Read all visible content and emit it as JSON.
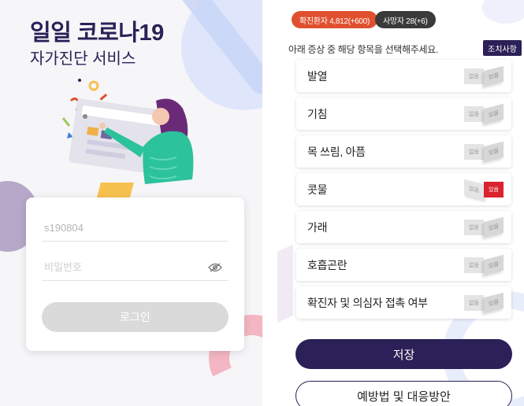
{
  "login": {
    "title": "일일 코로나19",
    "subtitle": "자가진단 서비스",
    "id_value": "s190804",
    "password_placeholder": "비밀번호",
    "login_label": "로그인",
    "eye_icon": "eye-slash-icon"
  },
  "survey": {
    "confirmed_badge": "확진환자 4,812(+600)",
    "death_badge": "사망자 28(+6)",
    "instruction": "아래 증상 중 해당 항목을 선택해주세요.",
    "action_label": "조치사항",
    "toggle_no": "없음",
    "toggle_yes": "있음",
    "symptoms": [
      {
        "label": "발열",
        "selected": false
      },
      {
        "label": "기침",
        "selected": false
      },
      {
        "label": "목 쓰림, 아픔",
        "selected": false
      },
      {
        "label": "콧물",
        "selected": true
      },
      {
        "label": "가래",
        "selected": false
      },
      {
        "label": "호흡곤란",
        "selected": false
      },
      {
        "label": "확진자 및 의심자 접촉 여부",
        "selected": false
      }
    ],
    "save_label": "저장",
    "prevention_label": "예방법 및 대응방안"
  },
  "colors": {
    "brand": "#2b2057",
    "confirmed": "#e0502f",
    "death": "#3a3a3a",
    "selected": "#d9232e"
  }
}
